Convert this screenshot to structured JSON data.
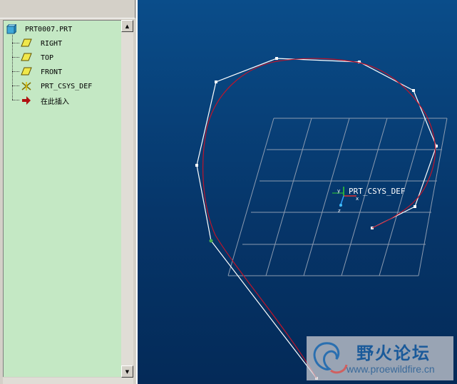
{
  "tree": {
    "root_label": "PRT0007.PRT",
    "items": [
      {
        "label": "RIGHT",
        "icon": "datum-plane-icon"
      },
      {
        "label": "TOP",
        "icon": "datum-plane-icon"
      },
      {
        "label": "FRONT",
        "icon": "datum-plane-icon"
      },
      {
        "label": "PRT_CSYS_DEF",
        "icon": "coordinate-system-icon"
      },
      {
        "label": "在此插入",
        "icon": "insert-here-arrow-icon"
      }
    ]
  },
  "viewport": {
    "csys_label": "PRT_CSYS_DEF",
    "axis_x": "x",
    "axis_y": "y",
    "axis_z": "z"
  },
  "watermark": {
    "title": "野火论坛",
    "url": "www.proewildfire.cn"
  },
  "colors": {
    "tree_bg": "#c4e8c4",
    "viewport_top": "#0a4d8a",
    "viewport_bottom": "#042a58",
    "curve": "#c0142a",
    "control_polygon": "#ffffff",
    "grid": "#9aa6b8"
  }
}
